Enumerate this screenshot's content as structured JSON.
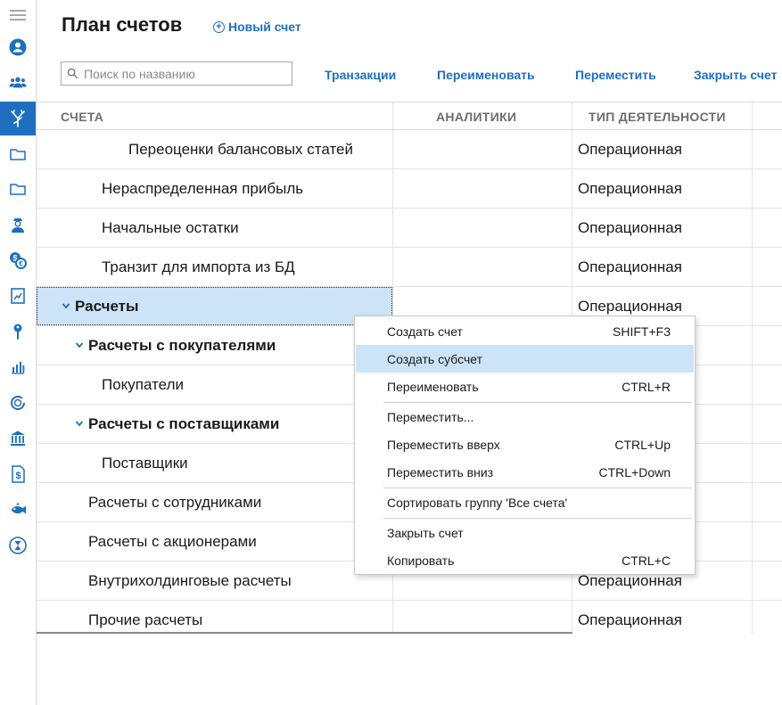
{
  "header": {
    "title": "План счетов",
    "new_account_label": "Новый счет"
  },
  "search": {
    "placeholder": "Поиск по названию"
  },
  "toolbar": {
    "transactions": "Транзакции",
    "rename": "Переименовать",
    "move": "Переместить",
    "close_account": "Закрыть счет"
  },
  "table": {
    "columns": [
      "СЧЕТА",
      "АНАЛИТИКИ",
      "ТИП ДЕЯТЕЛЬНОСТИ"
    ],
    "rows": [
      {
        "name": "Переоценки балансовых статей",
        "type": "Операционная"
      },
      {
        "name": "Нераспределенная прибыль",
        "type": "Операционная"
      },
      {
        "name": "Начальные остатки",
        "type": "Операционная"
      },
      {
        "name": "Транзит для импорта из БД",
        "type": "Операционная"
      },
      {
        "name": "Расчеты",
        "type": "Операционная"
      },
      {
        "name": "Расчеты с покупателями",
        "type": ""
      },
      {
        "name": "Покупатели",
        "type": ""
      },
      {
        "name": "Расчеты с поставщиками",
        "type": ""
      },
      {
        "name": "Поставщики",
        "type": ""
      },
      {
        "name": "Расчеты с сотрудниками",
        "type": ""
      },
      {
        "name": "Расчеты с акционерами",
        "type": ""
      },
      {
        "name": "Внутрихолдинговые расчеты",
        "type": "Операционная"
      },
      {
        "name": "Прочие расчеты",
        "type": "Операционная"
      }
    ]
  },
  "context_menu": {
    "items": [
      {
        "label": "Создать счет",
        "shortcut": "SHIFT+F3"
      },
      {
        "label": "Создать субсчет",
        "shortcut": ""
      },
      {
        "label": "Переименовать",
        "shortcut": "CTRL+R"
      },
      {
        "label": "Переместить...",
        "shortcut": ""
      },
      {
        "label": "Переместить вверх",
        "shortcut": "CTRL+Up"
      },
      {
        "label": "Переместить вниз",
        "shortcut": "CTRL+Down"
      },
      {
        "label": "Сортировать группу 'Все счета'",
        "shortcut": ""
      },
      {
        "label": "Закрыть счет",
        "shortcut": ""
      },
      {
        "label": "Копировать",
        "shortcut": "CTRL+C"
      }
    ]
  },
  "sidebar": {
    "icons": [
      "menu-icon",
      "user-icon",
      "users-icon",
      "tree-icon",
      "folder-icon",
      "folder-icon",
      "operator-icon",
      "currency-exchange-icon",
      "report-icon",
      "key-icon",
      "bar-chart-icon",
      "cycle-icon",
      "bank-icon",
      "dollar-doc-icon",
      "fish-icon",
      "hourglass-icon"
    ]
  },
  "colors": {
    "accent": "#1e6fbf",
    "selection": "#cde3f7"
  }
}
